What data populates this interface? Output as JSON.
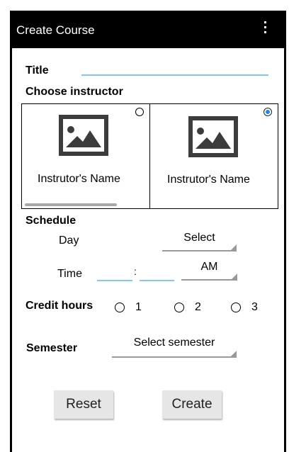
{
  "appbar": {
    "title": "Create Course",
    "menu_icon": "vertical-dots-icon"
  },
  "title_field": {
    "label": "Title",
    "value": ""
  },
  "instructors": {
    "label": "Choose instructor",
    "items": [
      {
        "name": "Instrutor's Name",
        "selected": false,
        "icon": "image-placeholder-icon"
      },
      {
        "name": "Instrutor's Name",
        "selected": true,
        "icon": "image-placeholder-icon"
      }
    ]
  },
  "schedule": {
    "label": "Schedule",
    "day_label": "Day",
    "day_value": "Select",
    "time_label": "Time",
    "time_separator": ":",
    "time_hour": "",
    "time_minute": "",
    "ampm_value": "AM"
  },
  "credit_hours": {
    "label": "Credit hours",
    "options": [
      "1",
      "2",
      "3"
    ]
  },
  "semester": {
    "label": "Semester",
    "value": "Select semester"
  },
  "buttons": {
    "reset": "Reset",
    "create": "Create"
  },
  "colors": {
    "accent": "#1e88e5",
    "underline": "#7fc9f0",
    "appbar": "#000000"
  }
}
